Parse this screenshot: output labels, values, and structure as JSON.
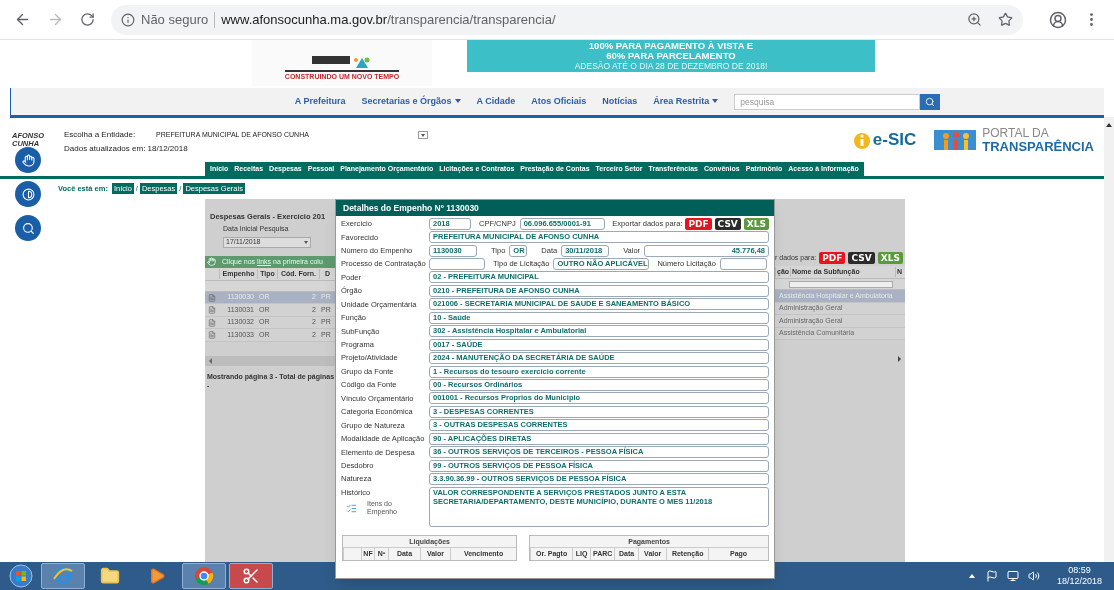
{
  "browser": {
    "security": "Não seguro",
    "url_host": "www.afonsocunha.ma.gov.br",
    "url_path": "/transparencia/transparencia/"
  },
  "banner": {
    "logo_tagline": "CONSTRUINDO UM NOVO TEMPO",
    "lines": [
      "100% PARA PAGAMENTO À VISTA E",
      "60% PARA PARCELAMENTO",
      "ADESÃO ATÉ O DIA 28 DE DEZEMBRO DE 2018!"
    ]
  },
  "site_nav": {
    "items": [
      {
        "label": "A Prefeitura",
        "dropdown": false
      },
      {
        "label": "Secretarias e Órgãos",
        "dropdown": true
      },
      {
        "label": "A Cidade",
        "dropdown": false
      },
      {
        "label": "Atos Oficiais",
        "dropdown": false
      },
      {
        "label": "Notícias",
        "dropdown": false
      },
      {
        "label": "Área Restrita",
        "dropdown": true
      }
    ],
    "search": {
      "placeholder": "pesquisa"
    }
  },
  "header": {
    "logo_lines": [
      "AFONSO",
      "CUNHA"
    ],
    "entity_label": "Escolha a Entidade:",
    "entity": "PREFEITURA MUNICIPAL DE AFONSO CUNHA",
    "updated": "Dados atualizados em: 18/12/2018",
    "esic": "e-SIC",
    "portal": [
      "PORTAL DA",
      "TRANSPARÊNCIA"
    ]
  },
  "menu": [
    "Início",
    "Receitas",
    "Despesas",
    "Pessoal",
    "Planejamento Orçamentário",
    "Licitações e Contratos",
    "Prestação de Contas",
    "Terceiro Setor",
    "Transferências",
    "Convênios",
    "Patrimônio",
    "Acesso à Informação"
  ],
  "breadcrumb": {
    "label": "Você está em:",
    "separator": "/",
    "links": [
      "Início",
      "Despesas",
      "Despesas Gerais"
    ]
  },
  "background": {
    "title": "Despesas Gerais - Exercício 201",
    "date_label": "Data Inicial Pesquisa",
    "date": "17/11/2018",
    "hint": {
      "before": "Clique nos",
      "link": "links",
      "after": "na primeira colu"
    },
    "export_label": "r dados para:",
    "left_columns": [
      "Empenho",
      "Tipo",
      "Cód. Forn.",
      "D"
    ],
    "right_columns": [
      "ção",
      "Nome da Subfunção",
      "N"
    ],
    "rows": [
      {
        "empenho": "1130030",
        "tipo": "OR",
        "cod": "2",
        "col_4": "PR",
        "subfuncao": "Assistência Hospitalar e Ambulatoria",
        "selected": true
      },
      {
        "empenho": "1130031",
        "tipo": "OR",
        "cod": "2",
        "col_4": "PR",
        "subfuncao": "Administração Geral",
        "selected": false
      },
      {
        "empenho": "1130032",
        "tipo": "OR",
        "cod": "2",
        "col_4": "PR",
        "subfuncao": "Administração Geral",
        "selected": false
      },
      {
        "empenho": "1130033",
        "tipo": "OR",
        "cod": "2",
        "col_4": "PR",
        "subfuncao": "Assistência Comunitária",
        "selected": false
      }
    ],
    "footer": "Mostrando página 3 - Total de páginas -",
    "export_buttons": [
      {
        "label": "PDF",
        "color": "#e8141c"
      },
      {
        "label": "CSV",
        "color": "#2b2b2b"
      },
      {
        "label": "XLS",
        "color": "#5a9a3a"
      }
    ]
  },
  "modal": {
    "title": "Detalhes do Empenho Nº 1130030",
    "export_label": "Exportar dados para:",
    "export_buttons": [
      {
        "label": "PDF",
        "color": "#e8141c"
      },
      {
        "label": "CSV",
        "color": "#2b2b2b"
      },
      {
        "label": "XLS",
        "color": "#5a9a3a"
      }
    ],
    "rows": [
      {
        "kind": "first",
        "label": "Exercício",
        "value": "2018",
        "extras": [
          {
            "label": "CPF/CNPJ",
            "value": "06.096.655/0001-91"
          }
        ]
      },
      {
        "kind": "wide",
        "label": "Favorecido",
        "value": "PREFEITURA MUNICIPAL DE AFONSO CUNHA"
      },
      {
        "kind": "numbers",
        "label": "Número do Empenho",
        "value": "1130030",
        "extras": [
          {
            "label": "Tipo",
            "value": "OR"
          },
          {
            "label": "Data",
            "value": "30/11/2018"
          },
          {
            "label": "Valor",
            "value": "45.776,48"
          }
        ]
      },
      {
        "kind": "process",
        "label": "Processo de Contratação",
        "extras": [
          {
            "label": "Tipo de Licitação",
            "value": "OUTRO NÃO APLICÁVEL"
          },
          {
            "label": "Número Licitação"
          }
        ]
      },
      {
        "kind": "wide",
        "label": "Poder",
        "value": "02 - PREFEITURA MUNICIPAL"
      },
      {
        "kind": "wide",
        "label": "Órgão",
        "value": "0210 - PREFEITURA DE AFONSO CUNHA"
      },
      {
        "kind": "wide",
        "label": "Unidade Orçamentária",
        "value": "021006 - SECRETARIA MUNICIPAL DE SAUDE E SANEAMENTO BÁSICO"
      },
      {
        "kind": "wide",
        "label": "Função",
        "value": "10 - Saúde"
      },
      {
        "kind": "wide",
        "label": "SubFunção",
        "value": "302 - Assistência Hospitalar e Ambulatorial"
      },
      {
        "kind": "wide",
        "label": "Programa",
        "value": "0017 - SAÚDE"
      },
      {
        "kind": "wide",
        "label": "Projeto/Atividade",
        "value": "2024 - MANUTENÇÃO DA SECRETÁRIA DE SAÚDE"
      },
      {
        "kind": "wide",
        "label": "Grupo da Fonte",
        "value": "1 - Recursos do tesouro exercício corrente"
      },
      {
        "kind": "wide",
        "label": "Código da Fonte",
        "value": "00 - Recursos Ordinários"
      },
      {
        "kind": "wide",
        "label": "Vínculo Orçamentário",
        "value": "001001 - Recursos Proprios do Municipio"
      },
      {
        "kind": "wide",
        "label": "Categoria Econômica",
        "value": "3 - DESPESAS CORRENTES"
      },
      {
        "kind": "wide",
        "label": "Grupo de Natureza",
        "value": "3 - OUTRAS DESPESAS CORRENTES"
      },
      {
        "kind": "wide",
        "label": "Modalidade de Aplicação",
        "value": "90 - APLICAÇÕES DIRETAS"
      },
      {
        "kind": "wide",
        "label": "Elemento de Despesa",
        "value": "36 - OUTROS SERVIÇOS DE TERCEIROS - PESSOA FÍSICA"
      },
      {
        "kind": "wide",
        "label": "Desdobro",
        "value": "99 - OUTROS SERVIÇOS DE PESSOA FÍSICA"
      },
      {
        "kind": "wide",
        "label": "Natureza",
        "value": "3.3.90.36.99 - OUTROS SERVIÇOS DE PESSOA FÍSICA"
      }
    ],
    "history": {
      "label": "Histórico",
      "value": "VALOR CORRESPONDENTE A SERVIÇOS PRESTADOS JUNTO A ESTA\nSECRETARIA/DEPARTAMENTO, DESTE MUNICÍPIO, DURANTE O MES 11/2018"
    },
    "items_link": "Itens do Empenho",
    "tables": [
      {
        "title": "Liquidações",
        "columns": [
          "",
          "NF",
          "Nº",
          "Data",
          "Valor",
          "Vencimento"
        ]
      },
      {
        "title": "Pagamentos",
        "columns": [
          "Or. Pagto",
          "LIQ",
          "PARC",
          "Data",
          "Valor",
          "Retenção",
          "Pago"
        ]
      }
    ]
  },
  "taskbar": {
    "apps": [
      {
        "kind": "ie",
        "running": true,
        "selected": false
      },
      {
        "kind": "folder",
        "running": false,
        "selected": false
      },
      {
        "kind": "media",
        "running": false,
        "selected": false
      },
      {
        "kind": "chrome",
        "running": true,
        "selected": false
      },
      {
        "kind": "scissors",
        "running": true,
        "selected": true
      }
    ],
    "time": "08:59",
    "date": "18/12/2018"
  }
}
